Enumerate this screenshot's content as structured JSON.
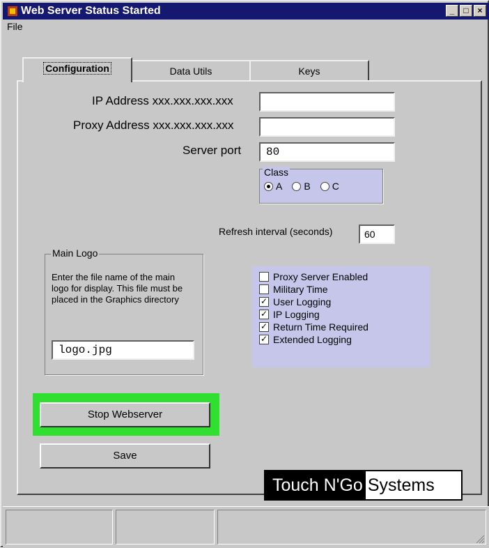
{
  "window": {
    "title": "Web Server Status Started",
    "controls": [
      "minimize",
      "maximize",
      "close"
    ]
  },
  "menu": {
    "file": "File"
  },
  "tabs": [
    {
      "label": "Configuration",
      "active": true
    },
    {
      "label": "Data Utils",
      "active": false
    },
    {
      "label": "Keys",
      "active": false
    }
  ],
  "config": {
    "ip_label": "IP Address xxx.xxx.xxx.xxx",
    "ip_value": "",
    "proxy_label": "Proxy Address xxx.xxx.xxx.xxx",
    "proxy_value": "",
    "port_label": "Server port",
    "port_value": "80",
    "class_legend": "Class",
    "class_options": [
      "A",
      "B",
      "C"
    ],
    "class_selected": "A",
    "refresh_label": "Refresh interval (seconds)",
    "refresh_value": "60"
  },
  "logo_group": {
    "legend": "Main Logo",
    "description": "Enter the file name of the main logo for display.  This file must be placed in the Graphics directory",
    "value": "logo.jpg"
  },
  "options": [
    {
      "label": "Proxy Server Enabled",
      "checked": false
    },
    {
      "label": "Military Time",
      "checked": false
    },
    {
      "label": "User Logging",
      "checked": true
    },
    {
      "label": "IP Logging",
      "checked": true
    },
    {
      "label": "Return Time Required",
      "checked": true
    },
    {
      "label": "Extended Logging",
      "checked": true
    }
  ],
  "buttons": {
    "stop": "Stop Webserver",
    "save": "Save"
  },
  "brand": {
    "part1": "Touch N'Go",
    "part2": "Systems"
  },
  "colors": {
    "title_bar": "#141870",
    "highlight": "#30e030",
    "options_panel": "#c6c6ea"
  }
}
